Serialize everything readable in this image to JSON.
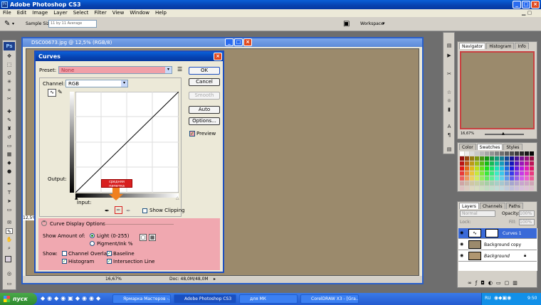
{
  "app": {
    "title": "Adobe Photoshop CS3"
  },
  "menu": [
    "File",
    "Edit",
    "Image",
    "Layer",
    "Select",
    "Filter",
    "View",
    "Window",
    "Help"
  ],
  "options_bar": {
    "sample_size_label": "Sample Size:",
    "sample_size_value": "11 by 11 Average",
    "workspace_label": "Workspace"
  },
  "document": {
    "title": "DSC00673.jpg @ 12,5% (RGB/8)",
    "zoom": "16,67%",
    "doc_info": "Doc: 48,0M/48,0M",
    "left_zoom": "12,5%",
    "canvas_color": "#9b8a6c"
  },
  "curves": {
    "title": "Curves",
    "preset_label": "Preset:",
    "preset_value": "None",
    "channel_label": "Channel:",
    "channel_value": "RGB",
    "output_label": "Output:",
    "input_label": "Input:",
    "show_clipping_label": "Show Clipping",
    "annotation": "средняя пипетка",
    "buttons": {
      "ok": "OK",
      "cancel": "Cancel",
      "smooth": "Smooth",
      "auto": "Auto",
      "options": "Options..."
    },
    "preview_label": "Preview",
    "display_options": {
      "header": "Curve Display Options",
      "show_amount_label": "Show Amount of:",
      "light_label": "Light (0-255)",
      "pigment_label": "Pigment/Ink %",
      "show_label": "Show:",
      "channel_overlays_label": "Channel Overlays",
      "baseline_label": "Baseline",
      "histogram_label": "Histogram",
      "intersection_label": "Intersection Line"
    }
  },
  "panels": {
    "navigator_tabs": [
      "Navigator",
      "Histogram",
      "Info"
    ],
    "navigator_zoom": "16,67%",
    "color_tabs": [
      "Color",
      "Swatches",
      "Styles"
    ],
    "layers_tabs": [
      "Layers",
      "Channels",
      "Paths"
    ],
    "blend_mode": "Normal",
    "opacity_label": "Opacity:",
    "opacity_value": "100%",
    "lock_label": "Lock:",
    "fill_label": "Fill:",
    "fill_value": "100%",
    "layers": [
      {
        "name": "Curves 1"
      },
      {
        "name": "Background copy"
      },
      {
        "name": "Background"
      }
    ]
  },
  "taskbar": {
    "start": "пуск",
    "tasks": [
      "Ярмарка Мастеров -...",
      "Adobe Photoshop CS3",
      "для МК",
      "CorelDRAW X3 - [Gra..."
    ],
    "lang": "RU",
    "clock": "9:50"
  }
}
